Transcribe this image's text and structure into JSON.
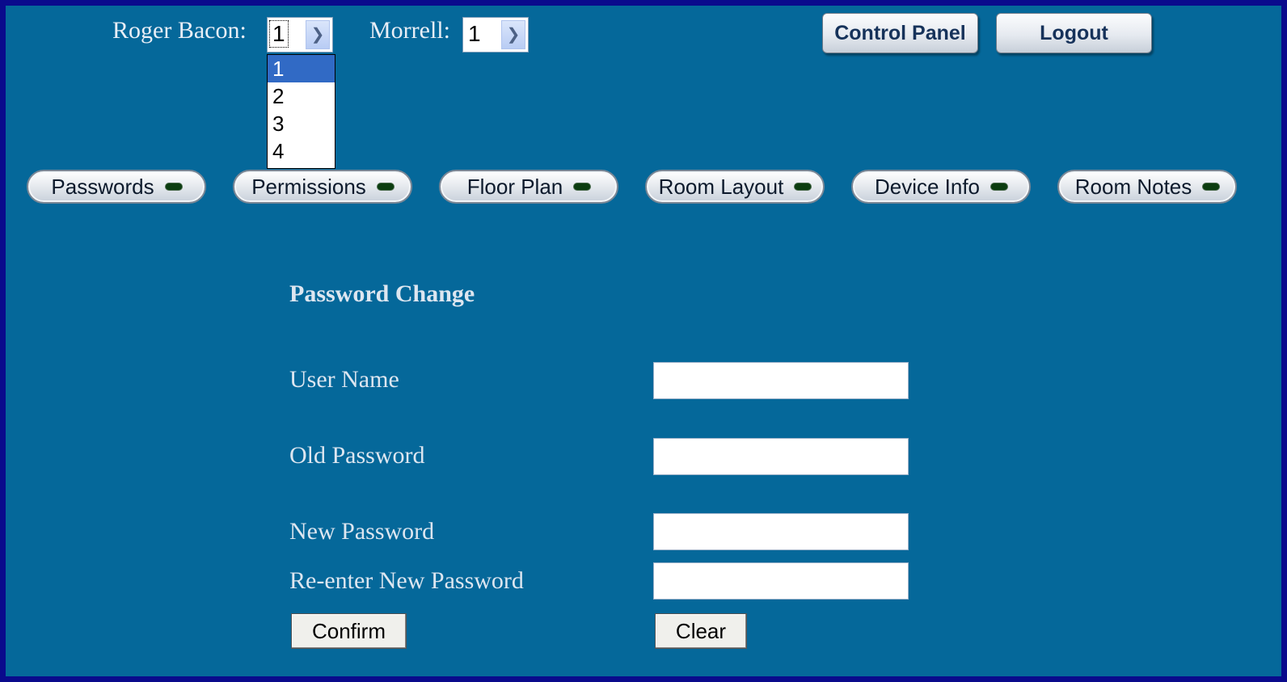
{
  "header": {
    "site1": {
      "label": "Roger Bacon:",
      "selected": "1",
      "options": [
        "1",
        "2",
        "3",
        "4"
      ],
      "highlighted": "1"
    },
    "site2": {
      "label": "Morrell:",
      "selected": "1"
    },
    "control_panel_label": "Control Panel",
    "logout_label": "Logout"
  },
  "nav": {
    "items": [
      {
        "label": "Passwords"
      },
      {
        "label": "Permissions"
      },
      {
        "label": "Floor Plan"
      },
      {
        "label": "Room Layout"
      },
      {
        "label": "Device Info"
      },
      {
        "label": "Room Notes"
      }
    ]
  },
  "form": {
    "title": "Password Change",
    "fields": [
      {
        "label": "User Name",
        "value": ""
      },
      {
        "label": "Old Password",
        "value": ""
      },
      {
        "label": "New Password",
        "value": ""
      },
      {
        "label": "Re-enter New Password",
        "value": ""
      }
    ],
    "confirm_label": "Confirm",
    "clear_label": "Clear"
  },
  "colors": {
    "outer_border": "#0a0a8c",
    "page_background": "#05689a",
    "selection_highlight": "#316ac5"
  }
}
